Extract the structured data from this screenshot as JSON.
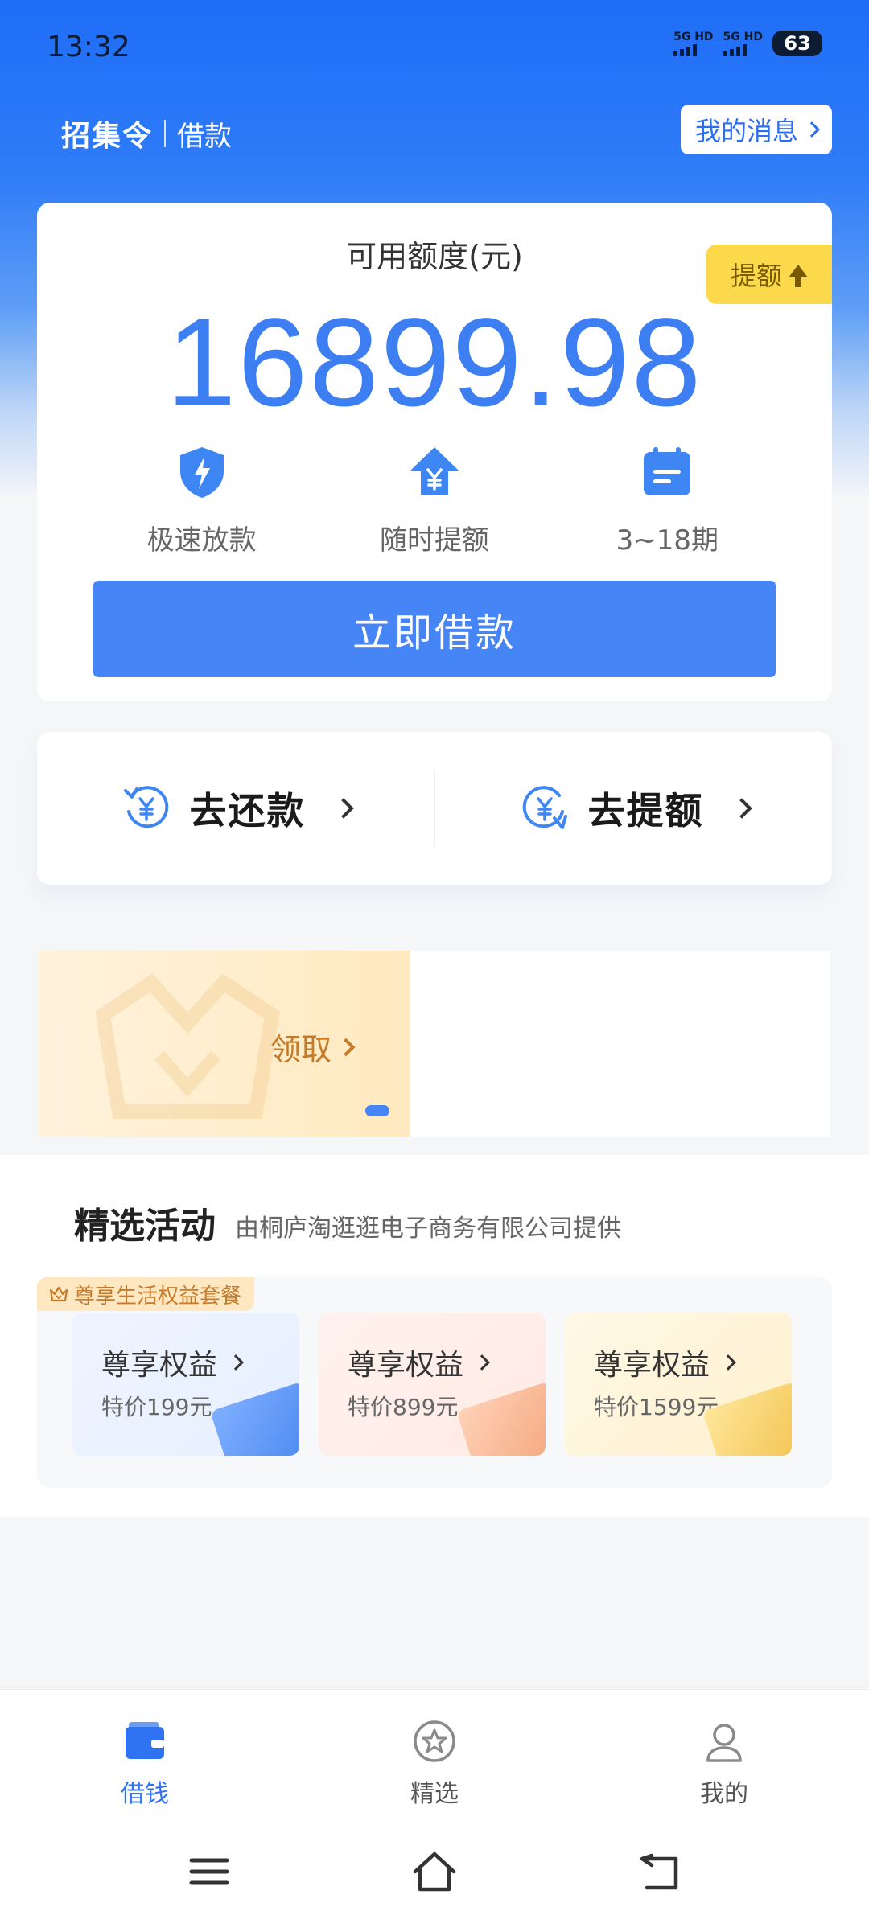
{
  "status": {
    "time": "13:32",
    "net1": "5G HD",
    "net2": "5G HD",
    "battery": "63"
  },
  "header": {
    "brand": "招集令",
    "section": "借款",
    "messages_label": "我的消息"
  },
  "credit": {
    "label": "可用额度(元)",
    "amount": "16899.98",
    "raise_badge": "提额"
  },
  "features": [
    {
      "label": "极速放款",
      "icon": "lightning-shield-icon"
    },
    {
      "label": "随时提额",
      "icon": "yuan-upgrade-icon"
    },
    {
      "label": "3~18期",
      "icon": "calendar-icon"
    }
  ],
  "borrow_button": "立即借款",
  "actions": [
    {
      "label": "去还款",
      "icon": "repay-yuan-icon"
    },
    {
      "label": "去提额",
      "icon": "raise-yuan-icon"
    }
  ],
  "banner": {
    "claim_label": "领取"
  },
  "activities": {
    "title": "精选活动",
    "subtitle": "由桐庐淘逛逛电子商务有限公司提供",
    "tag": "尊享生活权益套餐",
    "cards": [
      {
        "name": "尊享权益",
        "price": "特价199元"
      },
      {
        "name": "尊享权益",
        "price": "特价899元"
      },
      {
        "name": "尊享权益",
        "price": "特价1599元"
      }
    ]
  },
  "tabbar": {
    "items": [
      {
        "label": "借钱",
        "active": true,
        "icon": "wallet-icon"
      },
      {
        "label": "精选",
        "active": false,
        "icon": "star-circle-icon"
      },
      {
        "label": "我的",
        "active": false,
        "icon": "user-icon"
      }
    ]
  },
  "colors": {
    "primary": "#4585f5",
    "amount": "#3d7ef2",
    "badge": "#fbd94b",
    "claim": "#c57b2a"
  }
}
